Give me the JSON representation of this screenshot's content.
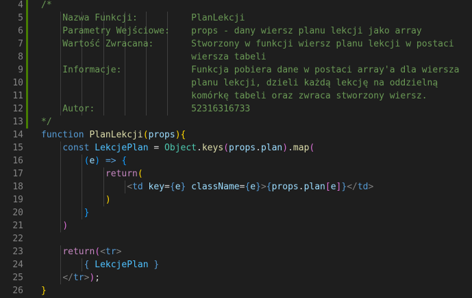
{
  "editor": {
    "lines": [
      {
        "num": "4",
        "modified": true,
        "tokens": [
          {
            "t": "/*",
            "c": "c-com"
          }
        ]
      },
      {
        "num": "5",
        "modified": true,
        "tokens": [
          {
            "t": "    Nazwa Funkcji:          PlanLekcji",
            "c": "c-com"
          }
        ]
      },
      {
        "num": "6",
        "modified": true,
        "tokens": [
          {
            "t": "    Parametry Wejściowe:    props - dany wiersz planu lekcji jako array",
            "c": "c-com"
          }
        ]
      },
      {
        "num": "7",
        "modified": true,
        "tokens": [
          {
            "t": "    Wartość Zwracana:       Stworzony w funkcji wiersz planu lekcji w postaci",
            "c": "c-com"
          }
        ]
      },
      {
        "num": "8",
        "modified": true,
        "tokens": [
          {
            "t": "                            wiersza tabeli",
            "c": "c-com"
          }
        ]
      },
      {
        "num": "9",
        "modified": true,
        "tokens": [
          {
            "t": "    Informacje:             Funkcja pobiera dane w postaci array'a dla wiersza",
            "c": "c-com"
          }
        ]
      },
      {
        "num": "10",
        "modified": true,
        "tokens": [
          {
            "t": "                            planu lekcji, dzieli każdą lekcję na oddzielną",
            "c": "c-com"
          }
        ]
      },
      {
        "num": "11",
        "modified": true,
        "tokens": [
          {
            "t": "                            komórkę tabeli oraz zwraca stworzony wiersz.",
            "c": "c-com"
          }
        ]
      },
      {
        "num": "12",
        "modified": true,
        "tokens": [
          {
            "t": "    Autor:                  52316316733",
            "c": "c-com"
          }
        ]
      },
      {
        "num": "13",
        "modified": true,
        "tokens": [
          {
            "t": "*/",
            "c": "c-com"
          }
        ]
      },
      {
        "num": "14",
        "modified": false,
        "tokens": [
          {
            "t": "function",
            "c": "c-kw"
          },
          {
            "t": " ",
            "c": "c-punc"
          },
          {
            "t": "PlanLekcji",
            "c": "c-fn"
          },
          {
            "t": "(",
            "c": "b1"
          },
          {
            "t": "props",
            "c": "c-var"
          },
          {
            "t": ")",
            "c": "b1"
          },
          {
            "t": "{",
            "c": "b1"
          }
        ]
      },
      {
        "num": "15",
        "modified": false,
        "tokens": [
          {
            "t": "    ",
            "c": "c-punc"
          },
          {
            "t": "const",
            "c": "c-kw"
          },
          {
            "t": " ",
            "c": "c-punc"
          },
          {
            "t": "LekcjePlan",
            "c": "c-const"
          },
          {
            "t": " = ",
            "c": "c-punc"
          },
          {
            "t": "Object",
            "c": "c-cls"
          },
          {
            "t": ".",
            "c": "c-punc"
          },
          {
            "t": "keys",
            "c": "c-fn"
          },
          {
            "t": "(",
            "c": "b2"
          },
          {
            "t": "props",
            "c": "c-var"
          },
          {
            "t": ".",
            "c": "c-punc"
          },
          {
            "t": "plan",
            "c": "c-var"
          },
          {
            "t": ")",
            "c": "b2"
          },
          {
            "t": ".",
            "c": "c-punc"
          },
          {
            "t": "map",
            "c": "c-fn"
          },
          {
            "t": "(",
            "c": "b2"
          }
        ]
      },
      {
        "num": "16",
        "modified": false,
        "tokens": [
          {
            "t": "        ",
            "c": "c-punc"
          },
          {
            "t": "(",
            "c": "b3"
          },
          {
            "t": "e",
            "c": "c-var"
          },
          {
            "t": ")",
            "c": "b3"
          },
          {
            "t": " ",
            "c": "c-punc"
          },
          {
            "t": "=>",
            "c": "c-kw"
          },
          {
            "t": " ",
            "c": "c-punc"
          },
          {
            "t": "{",
            "c": "b3"
          }
        ]
      },
      {
        "num": "17",
        "modified": false,
        "tokens": [
          {
            "t": "            ",
            "c": "c-punc"
          },
          {
            "t": "return",
            "c": "c-ctl"
          },
          {
            "t": "(",
            "c": "b1"
          }
        ]
      },
      {
        "num": "18",
        "modified": false,
        "tokens": [
          {
            "t": "                ",
            "c": "c-punc"
          },
          {
            "t": "<",
            "c": "c-tagp"
          },
          {
            "t": "td",
            "c": "c-tag"
          },
          {
            "t": " ",
            "c": "c-punc"
          },
          {
            "t": "key",
            "c": "c-attr"
          },
          {
            "t": "=",
            "c": "c-punc"
          },
          {
            "t": "{",
            "c": "c-kw"
          },
          {
            "t": "e",
            "c": "c-var"
          },
          {
            "t": "}",
            "c": "c-kw"
          },
          {
            "t": " ",
            "c": "c-punc"
          },
          {
            "t": "className",
            "c": "c-attr"
          },
          {
            "t": "=",
            "c": "c-punc"
          },
          {
            "t": "{",
            "c": "c-kw"
          },
          {
            "t": "e",
            "c": "c-var"
          },
          {
            "t": "}",
            "c": "c-kw"
          },
          {
            "t": ">",
            "c": "c-tagp"
          },
          {
            "t": "{",
            "c": "c-kw"
          },
          {
            "t": "props",
            "c": "c-var"
          },
          {
            "t": ".",
            "c": "c-punc"
          },
          {
            "t": "plan",
            "c": "c-var"
          },
          {
            "t": "[",
            "c": "b2"
          },
          {
            "t": "e",
            "c": "c-var"
          },
          {
            "t": "]",
            "c": "b2"
          },
          {
            "t": "}",
            "c": "c-kw"
          },
          {
            "t": "</",
            "c": "c-tagp"
          },
          {
            "t": "td",
            "c": "c-tag"
          },
          {
            "t": ">",
            "c": "c-tagp"
          }
        ]
      },
      {
        "num": "19",
        "modified": false,
        "tokens": [
          {
            "t": "            ",
            "c": "c-punc"
          },
          {
            "t": ")",
            "c": "b1"
          }
        ]
      },
      {
        "num": "20",
        "modified": false,
        "tokens": [
          {
            "t": "        ",
            "c": "c-punc"
          },
          {
            "t": "}",
            "c": "b3"
          }
        ]
      },
      {
        "num": "21",
        "modified": false,
        "tokens": [
          {
            "t": "    ",
            "c": "c-punc"
          },
          {
            "t": ")",
            "c": "b2"
          }
        ]
      },
      {
        "num": "22",
        "modified": false,
        "tokens": []
      },
      {
        "num": "23",
        "modified": false,
        "tokens": [
          {
            "t": "    ",
            "c": "c-punc"
          },
          {
            "t": "return",
            "c": "c-ctl"
          },
          {
            "t": "(",
            "c": "b2"
          },
          {
            "t": "<",
            "c": "c-tagp"
          },
          {
            "t": "tr",
            "c": "c-tag"
          },
          {
            "t": ">",
            "c": "c-tagp"
          }
        ]
      },
      {
        "num": "24",
        "modified": false,
        "tokens": [
          {
            "t": "        ",
            "c": "c-punc"
          },
          {
            "t": "{",
            "c": "c-kw"
          },
          {
            "t": " ",
            "c": "c-punc"
          },
          {
            "t": "LekcjePlan",
            "c": "c-const"
          },
          {
            "t": " ",
            "c": "c-punc"
          },
          {
            "t": "}",
            "c": "c-kw"
          }
        ]
      },
      {
        "num": "25",
        "modified": false,
        "tokens": [
          {
            "t": "    ",
            "c": "c-punc"
          },
          {
            "t": "</",
            "c": "c-tagp"
          },
          {
            "t": "tr",
            "c": "c-tag"
          },
          {
            "t": ">",
            "c": "c-tagp"
          },
          {
            "t": ")",
            "c": "b2"
          },
          {
            "t": ";",
            "c": "c-punc"
          }
        ]
      },
      {
        "num": "26",
        "modified": false,
        "tokens": [
          {
            "t": "}",
            "c": "b1"
          }
        ]
      }
    ]
  }
}
